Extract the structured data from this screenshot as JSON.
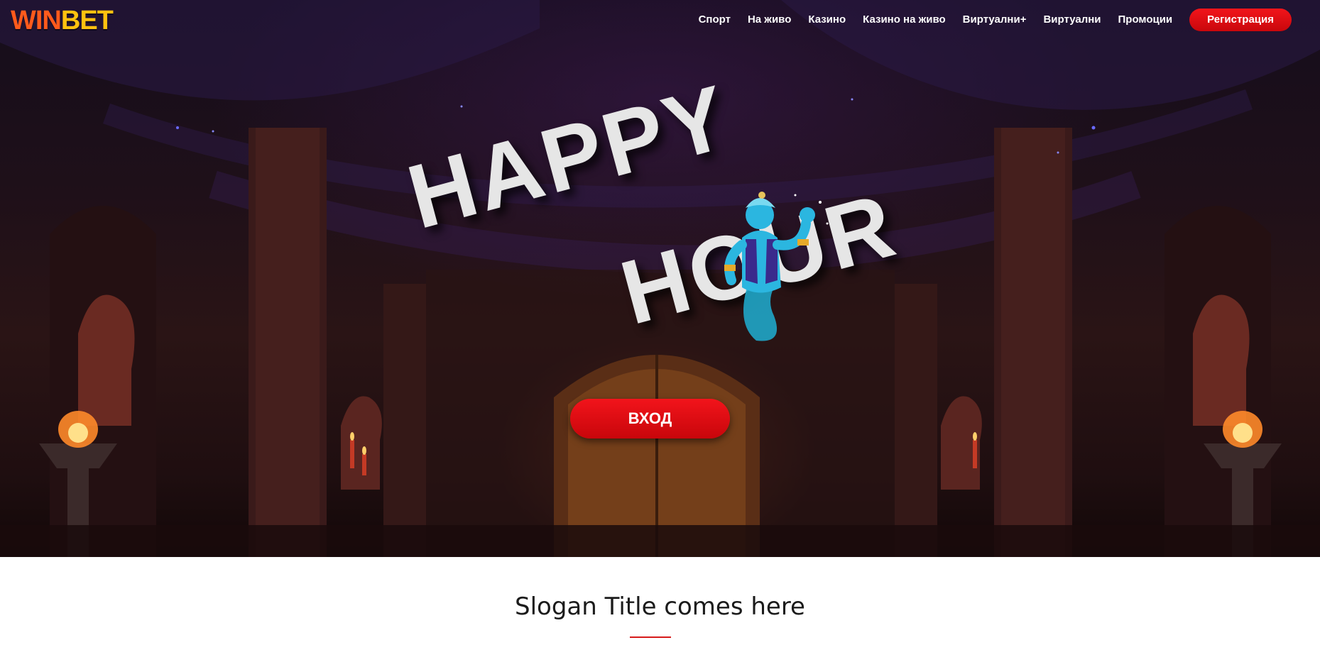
{
  "brand": {
    "logo_part1": "WIN",
    "logo_part2": "BET",
    "colors": {
      "win": "#ff5a1c",
      "bet": "#ffc20f",
      "accent_red": "#e10e14"
    }
  },
  "nav": {
    "items": [
      {
        "label": "Спорт"
      },
      {
        "label": "На живо"
      },
      {
        "label": "Казино"
      },
      {
        "label": "Казино на живо"
      },
      {
        "label": "Виртуални+"
      },
      {
        "label": "Виртуални"
      },
      {
        "label": "Промоции"
      }
    ],
    "register_label": "Регистрация"
  },
  "hero": {
    "headline_line1": "HAPPY",
    "headline_line2": "HOUR",
    "character_icon": "genie-icon",
    "login_label": "ВХОД"
  },
  "slogan": {
    "title": "Slogan Title comes here"
  }
}
